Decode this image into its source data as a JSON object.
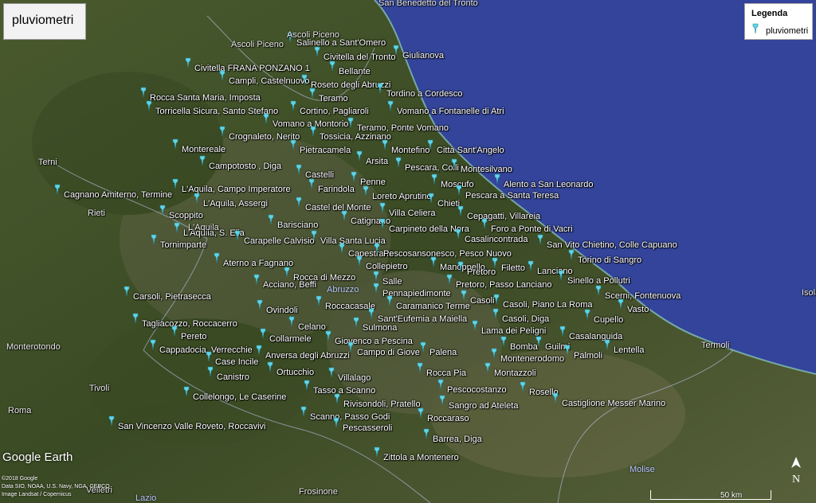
{
  "title": "pluviometri",
  "legend": {
    "title": "Legenda",
    "item": "pluviometri"
  },
  "brand": "Google Earth",
  "attribution": [
    "©2018 Google",
    "Data SIO, NOAA, U.S. Navy, NGA, GEBCO",
    "Image Landsat / Copernicus"
  ],
  "scale_label": "50 km",
  "north_label": "N",
  "colors": {
    "sea": "#33449a",
    "pin": "#5fd4e6",
    "land": "#3c4a26"
  },
  "stations": [
    "Salinello a Sant'Omero",
    "Civitella del Tronto",
    "Giulianova",
    "Civitella FRANA PONZANO 1",
    "Campli, Castelnuovo",
    "Bellante",
    "Roseto degli Abruzzi",
    "Tordino a Cordesco",
    "Rocca Santa Maria, Imposta",
    "Teramo",
    "Torricella Sicura, Santo Stefano",
    "Cortino, Pagliaroli",
    "Vomano a Fontanelle di Atri",
    "Vomano a Montorio",
    "Teramo, Ponte Vomano",
    "Crognaleto, Nerito",
    "Tossicia, Azzinano",
    "Montefino",
    "Città Sant'Angelo",
    "Pietracamela",
    "Montereale",
    "Arsita",
    "Pescara, Colli",
    "Montesilvano",
    "Campotosto , Diga",
    "Castelli",
    "Penne",
    "Farindola",
    "Moscufo",
    "Alento a San Leonardo",
    "Cagnano Amiterno, Termine",
    "L'Aquila, Campo Imperatore",
    "Loreto Aprutino",
    "Pescara a Santa Teresa",
    "L'Aquila, Assergi",
    "Castel del Monte",
    "Chieti",
    "Villa Celiera",
    "Scoppito",
    "Cepagatti, Villareia",
    "Catignano",
    "Barisciano",
    "Foro a Ponte di Vacri",
    "L'Aquila, S. Elia",
    "Carpineto della Nora",
    "Carapelle Calvisio",
    "Casalincontrada",
    "Villa Santa Lucia",
    "Tornimparte",
    "San Vito Chietino, Colle Capuano",
    "Capestrano",
    "Pescosansonesco, Pesco Nuovo",
    "Torino di Sangro",
    "Aterno a Fagnano",
    "Collepietro",
    "Manoppello",
    "Filetto",
    "Lanciano",
    "Pretoro",
    "Rocca di Mezzo",
    "Sinello a Pollutri",
    "Salle",
    "Pretoro, Passo Lanciano",
    "Acciano, Beffi",
    "Pennapiedimonte",
    "Scerni, Fontenuova",
    "Carsoli, Pietrasecca",
    "Casoli",
    "Caramanico Terme",
    "Roccacasale",
    "Casoli, Piano La Roma",
    "Vasto",
    "Ovindoli",
    "Sant'Eufemia a Maiella",
    "Casoli, Diga",
    "Cupello",
    "Tagliacozzo, Roccacerro",
    "Celano",
    "Sulmona",
    "Lama dei Peligni",
    "Casalanguida",
    "Pereto",
    "Collarmele",
    "Giovenco a Pescina",
    "Bomba",
    "Guilmi",
    "Lentella",
    "Cappadocia, Verrecchie",
    "Anversa degli Abruzzi",
    "Campo di Giove",
    "Palena",
    "Palmoli",
    "Montenerodomo",
    "Case Incile",
    "Ortucchio",
    "Rocca Pia",
    "Montazzoli",
    "Canistro",
    "Villalago",
    "Tasso a Scanno",
    "Pescocostanzo",
    "Rosello",
    "Collelongo, Le Caserine",
    "Castiglione Messer Marino",
    "Rivisondoli, Pratello",
    "Sangro ad Ateleta",
    "San Vincenzo Valle Roveto, Roccavivi",
    "Scanno, Passo Godi",
    "Roccaraso",
    "Pescasseroli",
    "Barrea, Diga",
    "Zittola a Montenero"
  ],
  "places": [
    "San Benedetto del Tronto",
    "Ascoli Piceno",
    "Ascoli Piceno",
    "Terni",
    "L'Aquila",
    "Rieti",
    "Abruzzo",
    "Monterotondo",
    "Tivoli",
    "Roma",
    "Lazio",
    "Molise",
    "Frosinone",
    "Termoli",
    "Isola",
    "Velletri"
  ]
}
